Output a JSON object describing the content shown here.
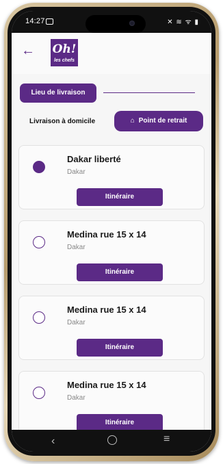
{
  "status_bar": {
    "time": "14:27",
    "icons": "✕ ≋ ᯤ ▮"
  },
  "header": {
    "logo_main": "Oh!",
    "logo_sub": "les chefs"
  },
  "tabs": {
    "lieu_label": "Lieu de livraison"
  },
  "delivery": {
    "home_label": "Livraison à domicile",
    "pickup_label": "Point de retrait"
  },
  "locations": [
    {
      "name": "Dakar liberté",
      "city": "Dakar",
      "button": "Itinéraire",
      "selected": true
    },
    {
      "name": "Medina rue 15 x 14",
      "city": "Dakar",
      "button": "Itinéraire",
      "selected": false
    },
    {
      "name": "Medina rue 15 x 14",
      "city": "Dakar",
      "button": "Itinéraire",
      "selected": false
    },
    {
      "name": "Medina rue 15 x 14",
      "city": "Dakar",
      "button": "Itinéraire",
      "selected": false
    }
  ],
  "nav": {
    "back": "‹",
    "menu": "≡"
  },
  "colors": {
    "accent": "#5b2a86"
  }
}
